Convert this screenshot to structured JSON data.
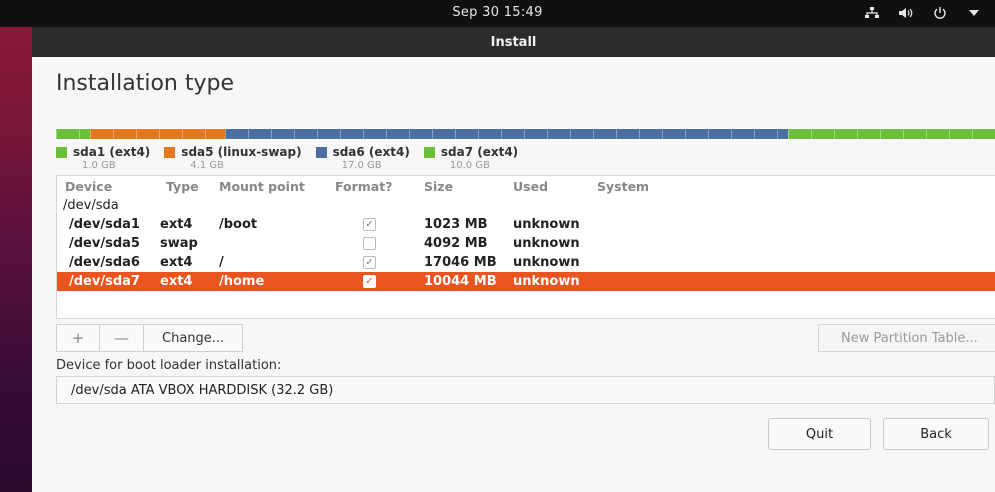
{
  "topbar": {
    "clock": "Sep 30  15:49",
    "tray_icons": [
      "network-icon",
      "volume-icon",
      "power-icon",
      "chevron-down-icon"
    ]
  },
  "window": {
    "title": "Install",
    "page_title": "Installation type"
  },
  "partition_bar": [
    {
      "name": "sda1",
      "color": "#6cbf3a",
      "fraction": 0.036
    },
    {
      "name": "sda5",
      "color": "#e3781f",
      "fraction": 0.144
    },
    {
      "name": "sda6",
      "color": "#4a6fa0",
      "fraction": 0.6
    },
    {
      "name": "sda7",
      "color": "#6cbf3a",
      "fraction": 0.22
    }
  ],
  "legend": [
    {
      "label": "sda1 (ext4)",
      "size": "1.0 GB",
      "color": "#6cbf3a"
    },
    {
      "label": "sda5 (linux-swap)",
      "size": "4.1 GB",
      "color": "#e3781f"
    },
    {
      "label": "sda6 (ext4)",
      "size": "17.0 GB",
      "color": "#4a6fa0"
    },
    {
      "label": "sda7 (ext4)",
      "size": "10.0 GB",
      "color": "#6cbf3a"
    }
  ],
  "table": {
    "headers": {
      "device": "Device",
      "type": "Type",
      "mount": "Mount point",
      "format": "Format?",
      "size": "Size",
      "used": "Used",
      "system": "System"
    },
    "group": "/dev/sda",
    "rows": [
      {
        "device": "/dev/sda1",
        "type": "ext4",
        "mount": "/boot",
        "format": true,
        "size": "1023 MB",
        "used": "unknown",
        "system": "",
        "selected": false
      },
      {
        "device": "/dev/sda5",
        "type": "swap",
        "mount": "",
        "format": false,
        "size": "4092 MB",
        "used": "unknown",
        "system": "",
        "selected": false
      },
      {
        "device": "/dev/sda6",
        "type": "ext4",
        "mount": "/",
        "format": true,
        "size": "17046 MB",
        "used": "unknown",
        "system": "",
        "selected": false
      },
      {
        "device": "/dev/sda7",
        "type": "ext4",
        "mount": "/home",
        "format": true,
        "size": "10044 MB",
        "used": "unknown",
        "system": "",
        "selected": true
      }
    ]
  },
  "toolbar": {
    "add": "+",
    "remove": "—",
    "change": "Change...",
    "new_partition_table": "New Partition Table..."
  },
  "boot_loader": {
    "label": "Device for boot loader installation:",
    "value": "/dev/sda   ATA VBOX HARDDISK (32.2 GB)"
  },
  "buttons": {
    "quit": "Quit",
    "back": "Back"
  },
  "colors": {
    "accent": "#e95420",
    "titlebar": "#2c2c2c"
  }
}
